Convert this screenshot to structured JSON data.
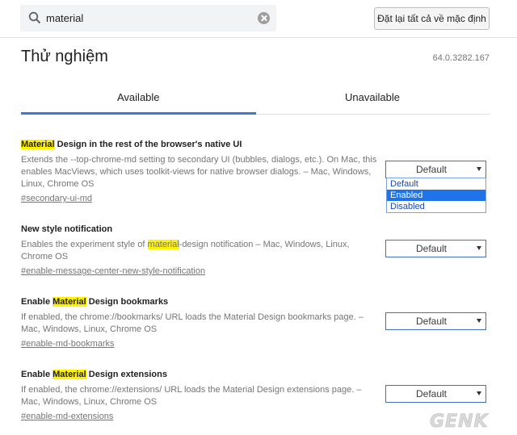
{
  "search": {
    "value": "material"
  },
  "reset_button": "Đặt lại tất cả về mặc định",
  "page_title": "Thử nghiệm",
  "version": "64.0.3282.167",
  "tabs": [
    {
      "label": "Available",
      "active": true
    },
    {
      "label": "Unavailable",
      "active": false
    }
  ],
  "experiments": [
    {
      "title_parts": [
        "Material",
        " Design in the rest of the browser's native UI"
      ],
      "desc": "Extends the --top-chrome-md setting to secondary UI (bubbles, dialogs, etc.). On Mac, this enables MacViews, which uses toolkit-views for native browser dialogs. – Mac, Windows, Linux, Chrome OS",
      "link": "#secondary-ui-md",
      "select": "Default"
    },
    {
      "title": "New style notification",
      "desc_parts": [
        "Enables the experiment style of ",
        "material",
        "-design notification – Mac, Windows, Linux, Chrome OS"
      ],
      "link": "#enable-message-center-new-style-notification",
      "select": "Default"
    },
    {
      "title_parts": [
        "Enable ",
        "Material",
        " Design bookmarks"
      ],
      "desc": "If enabled, the chrome://bookmarks/ URL loads the Material Design bookmarks page. – Mac, Windows, Linux, Chrome OS",
      "link": "#enable-md-bookmarks",
      "select": "Default"
    },
    {
      "title_parts": [
        "Enable ",
        "Material",
        " Design extensions"
      ],
      "desc": "If enabled, the chrome://extensions/ URL loads the Material Design extensions page. – Mac, Windows, Linux, Chrome OS",
      "link": "#enable-md-extensions",
      "select": "Default"
    }
  ],
  "dropdown_options": [
    {
      "label": "Default",
      "selected": false
    },
    {
      "label": "Enabled",
      "selected": true
    },
    {
      "label": "Disabled",
      "selected": false
    }
  ],
  "watermark": "GENK",
  "colors": {
    "accent": "#3f76d1",
    "highlight": "#fff200",
    "select_border": "#3f6fc6",
    "option_selected": "#1e73e8"
  },
  "icons": {
    "search": "magnifier-icon",
    "clear": "clear-x-icon",
    "dropdown": "triangle-down-icon"
  }
}
